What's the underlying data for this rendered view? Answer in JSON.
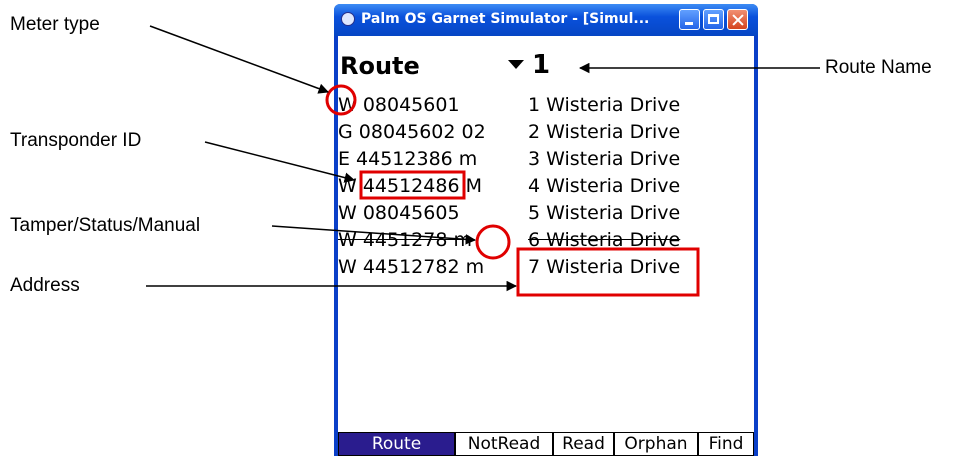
{
  "callouts": {
    "meter_type": "Meter type",
    "transponder_id": "Transponder ID",
    "tamper_status": "Tamper/Status/Manual",
    "address": "Address",
    "route_name": "Route Name"
  },
  "window": {
    "title": "Palm OS Garnet Simulator - [Simul..."
  },
  "screen": {
    "form_title": "Route",
    "route_value": "1",
    "rows": [
      {
        "meter": "W 08045601",
        "address": "1 Wisteria Drive"
      },
      {
        "meter": "G 08045602 02",
        "address": "2 Wisteria Drive"
      },
      {
        "meter": "E 44512386 m",
        "address": "3 Wisteria Drive"
      },
      {
        "meter": "W 44512486 M",
        "address": "4 Wisteria Drive"
      },
      {
        "meter": "W 08045605",
        "address": "5 Wisteria Drive"
      },
      {
        "meter": "W 4451278 m",
        "address": "6 Wisteria Drive"
      },
      {
        "meter": "W 44512782 m",
        "address": "7 Wisteria Drive"
      }
    ],
    "tabs": [
      "Route",
      "NotRead",
      "Read",
      "Orphan",
      "Find"
    ],
    "active_tab": "Route"
  },
  "colors": {
    "highlight": "#e00000",
    "title_bar": "#0a51dc",
    "active_tab": "#2a1c8e"
  }
}
